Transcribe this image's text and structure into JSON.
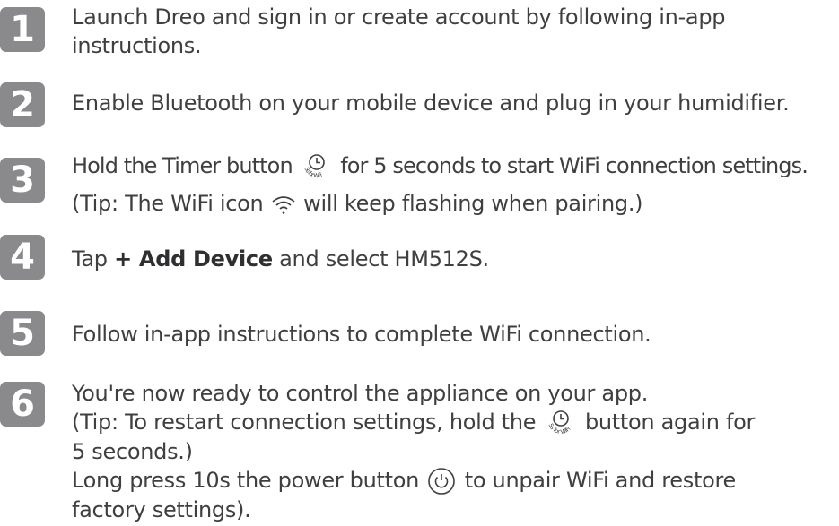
{
  "steps": [
    {
      "number": "1",
      "lines": [
        "Launch Dreo and sign in or create account by following in-app",
        "instructions."
      ]
    },
    {
      "number": "2",
      "lines": [
        "Enable Bluetooth on your mobile device and plug in your humidifier."
      ]
    },
    {
      "number": "3",
      "l1a": "Hold the Timer  button ",
      "l1b": " for 5 seconds to start WiFi connection settings.",
      "l2a": "(Tip: The WiFi icon ",
      "l2b": " will keep flashing when pairing.)",
      "timer_icon_text": "5s for WiFi",
      "timer_icon": "timer-icon",
      "wifi_icon": "wifi-icon"
    },
    {
      "number": "4",
      "a": "Tap ",
      "bold": "+ Add Device",
      "b": " and select HM512S."
    },
    {
      "number": "5",
      "lines": [
        "Follow in-app instructions to complete WiFi connection."
      ]
    },
    {
      "number": "6",
      "l1": "You're now ready to control the appliance on your app.",
      "l2a": "(Tip: To restart connection settings, hold the ",
      "l2b": " button again for",
      "l3": "5 seconds.)",
      "l4a": "Long press 10s the power button ",
      "l4b": " to unpair WiFi and restore",
      "l5": "factory settings).",
      "timer_icon_text": "5s for WiFi",
      "power_icon": "power-icon"
    }
  ],
  "colors": {
    "badge": "#8a8a8d",
    "text": "#3f3f42"
  }
}
